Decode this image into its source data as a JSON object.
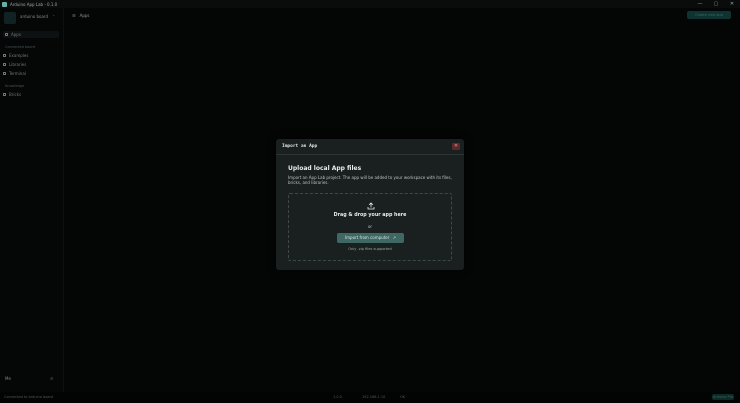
{
  "window": {
    "title": "Arduino App Lab - 0.1.0",
    "controls": [
      "—",
      "▢",
      "✕"
    ]
  },
  "sidebar": {
    "board_name": "arduino board",
    "nav_apps": "Apps",
    "section_board": "Connected board",
    "items_board": [
      "Examples",
      "Libraries",
      "Terminal"
    ],
    "section_learn": "Knowledge",
    "items_learn": [
      "Bricks"
    ],
    "user_label": "Me"
  },
  "header": {
    "breadcrumb": "Apps",
    "create_button": "Create new app"
  },
  "modal": {
    "title": "Import an App",
    "close_label": "✕",
    "upload_title": "Upload local App files",
    "upload_desc": "Import an App Lab project. The app will be added to your workspace with its files, bricks, and libraries.",
    "drop_title": "Drag & drop your app here",
    "or_label": "or",
    "import_button": "Import from computer",
    "note": "Only .zip files supported"
  },
  "statusbar": {
    "left": "Connected to arduino board",
    "center_a": "1.0.0",
    "center_b": "192.168.1.10",
    "center_c": "OK",
    "pill": "Arduino Pro"
  },
  "colors": {
    "accent": "#3f6764",
    "modal_bg": "#1a2020",
    "close_bg": "#5a2a2a"
  }
}
